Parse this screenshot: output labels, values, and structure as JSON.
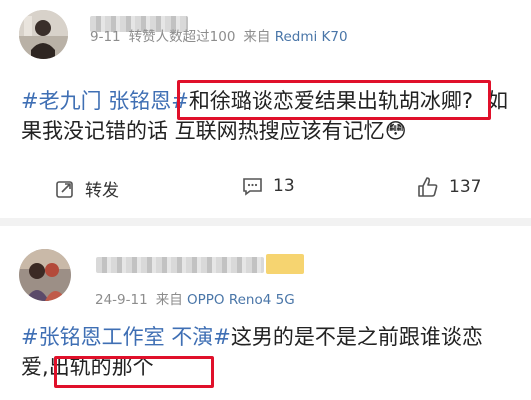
{
  "posts": [
    {
      "meta": {
        "date": "9-11",
        "likes_text": "转赞人数超过100",
        "source_prefix": "来自",
        "device": "Redmi K70"
      },
      "content": {
        "tag": "#老九门 张铭恩#",
        "highlight": "和徐璐谈恋爱结果出轨胡冰卿?",
        "rest_line1": "如",
        "line2": "果我没记错的话 互联网热搜应该有记忆",
        "emoji": "😳"
      },
      "actions": {
        "repost_label": "转发",
        "comment_count": "13",
        "like_count": "137"
      }
    },
    {
      "meta": {
        "date": "24-9-11",
        "source_prefix": "来自",
        "device": "OPPO Reno4 5G"
      },
      "content": {
        "tag": "#张铭恩工作室 不演#",
        "rest_line1": "这男的是不是之前跟谁谈恋",
        "line2_prefix": "爱,",
        "highlight": "出轨的那个"
      }
    }
  ],
  "colors": {
    "link": "#3f6fb4",
    "highlight_box": "#e0102a",
    "meta": "#8d8d8d"
  }
}
